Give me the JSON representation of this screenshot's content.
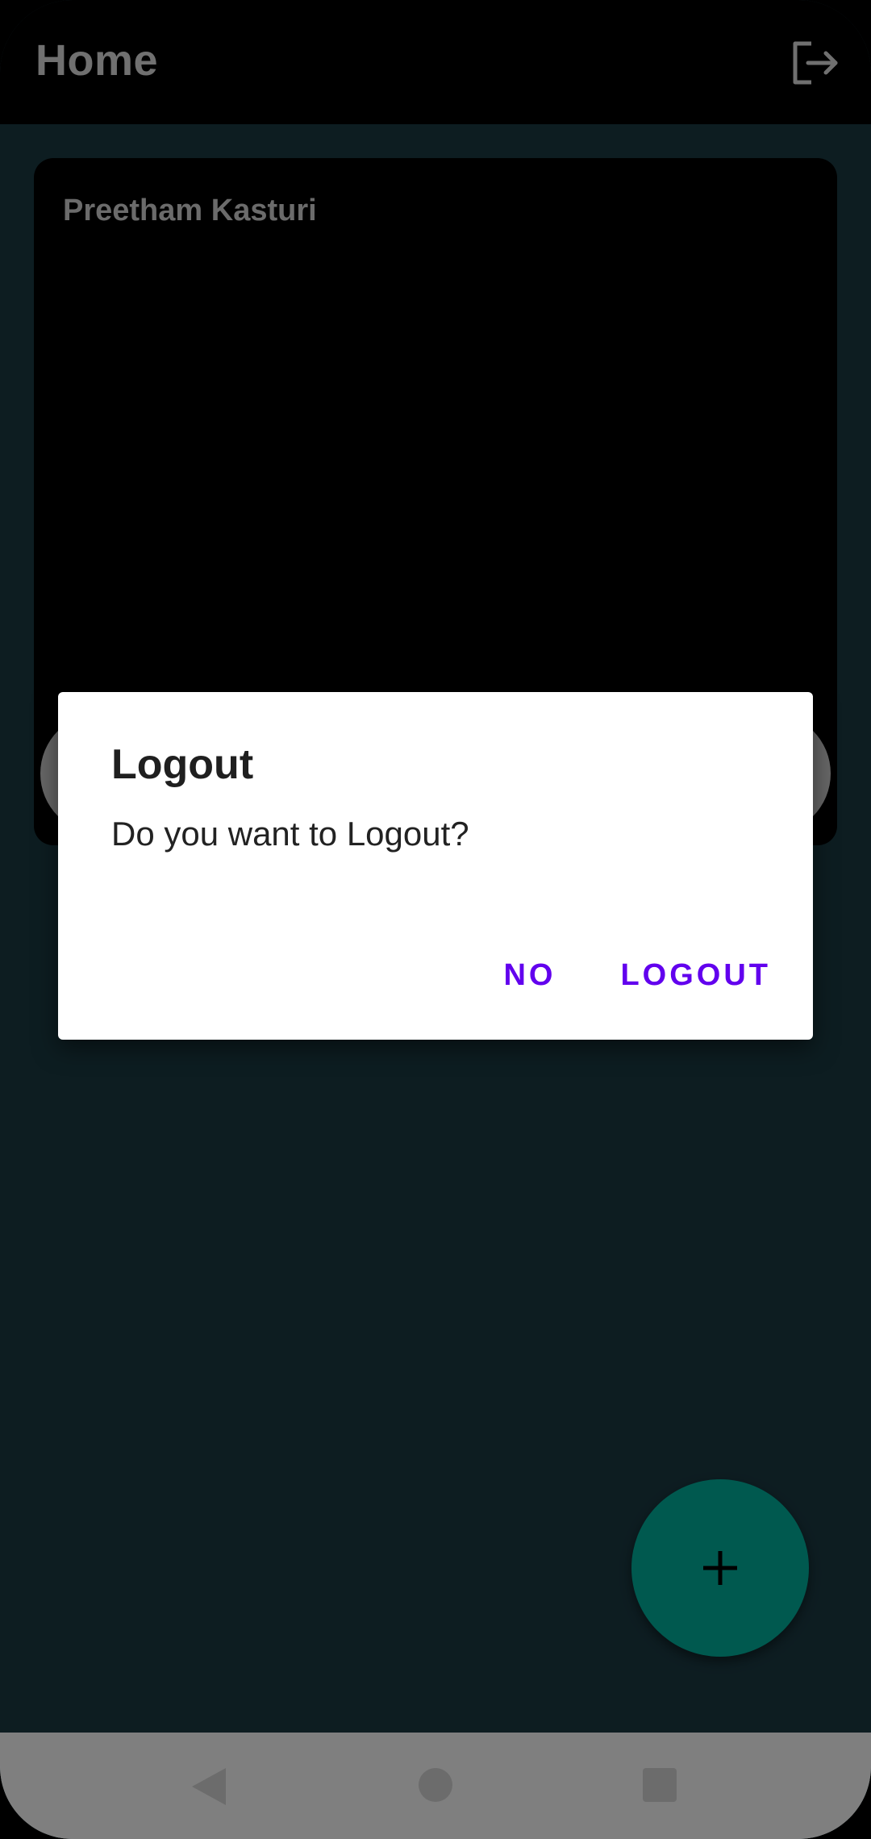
{
  "app_bar": {
    "title": "Home",
    "logout_icon": "logout-icon"
  },
  "profile_card": {
    "name": "Preetham Kasturi"
  },
  "fab": {
    "icon": "plus-icon",
    "color": "#00b39f"
  },
  "dialog": {
    "title": "Logout",
    "message": "Do you want to Logout?",
    "negative_label": "NO",
    "positive_label": "LOGOUT",
    "accent_color": "#6200ee"
  },
  "nav_bar": {
    "back_icon": "back-triangle-icon",
    "home_icon": "home-circle-icon",
    "recents_icon": "recents-square-icon"
  }
}
